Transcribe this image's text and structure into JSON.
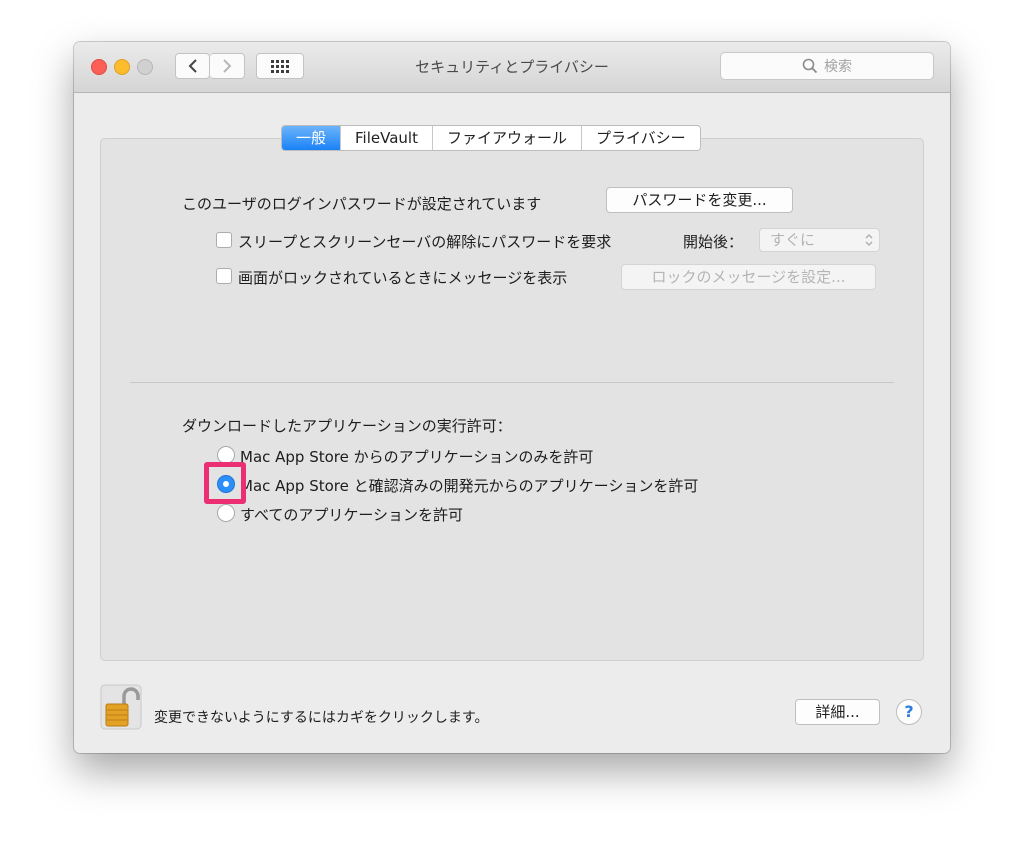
{
  "window": {
    "title": "セキュリティとプライバシー",
    "search_placeholder": "検索"
  },
  "tabs": [
    {
      "label": "一般",
      "active": true
    },
    {
      "label": "FileVault",
      "active": false
    },
    {
      "label": "ファイアウォール",
      "active": false
    },
    {
      "label": "プライバシー",
      "active": false
    }
  ],
  "general": {
    "password_status": "このユーザのログインパスワードが設定されています",
    "change_password_label": "パスワードを変更...",
    "require_password_label": "スリープとスクリーンセーバの解除にパスワードを要求",
    "require_password_checked": false,
    "delay_label": "開始後：",
    "delay_value": "すぐに",
    "lock_message_label": "画面がロックされているときにメッセージを表示",
    "lock_message_checked": false,
    "set_lock_message_label": "ロックのメッセージを設定..."
  },
  "gatekeeper": {
    "heading": "ダウンロードしたアプリケーションの実行許可：",
    "options": [
      {
        "label": "Mac App Store からのアプリケーションのみを許可",
        "selected": false
      },
      {
        "label": "Mac App Store と確認済みの開発元からのアプリケーションを許可",
        "selected": true
      },
      {
        "label": "すべてのアプリケーションを許可",
        "selected": false
      }
    ]
  },
  "footer": {
    "lock_text": "変更できないようにするにはカギをクリックします。",
    "advanced_label": "詳細...",
    "help_label": "?"
  },
  "colors": {
    "accent": "#2c8ef8",
    "highlight": "#ec2f72"
  }
}
